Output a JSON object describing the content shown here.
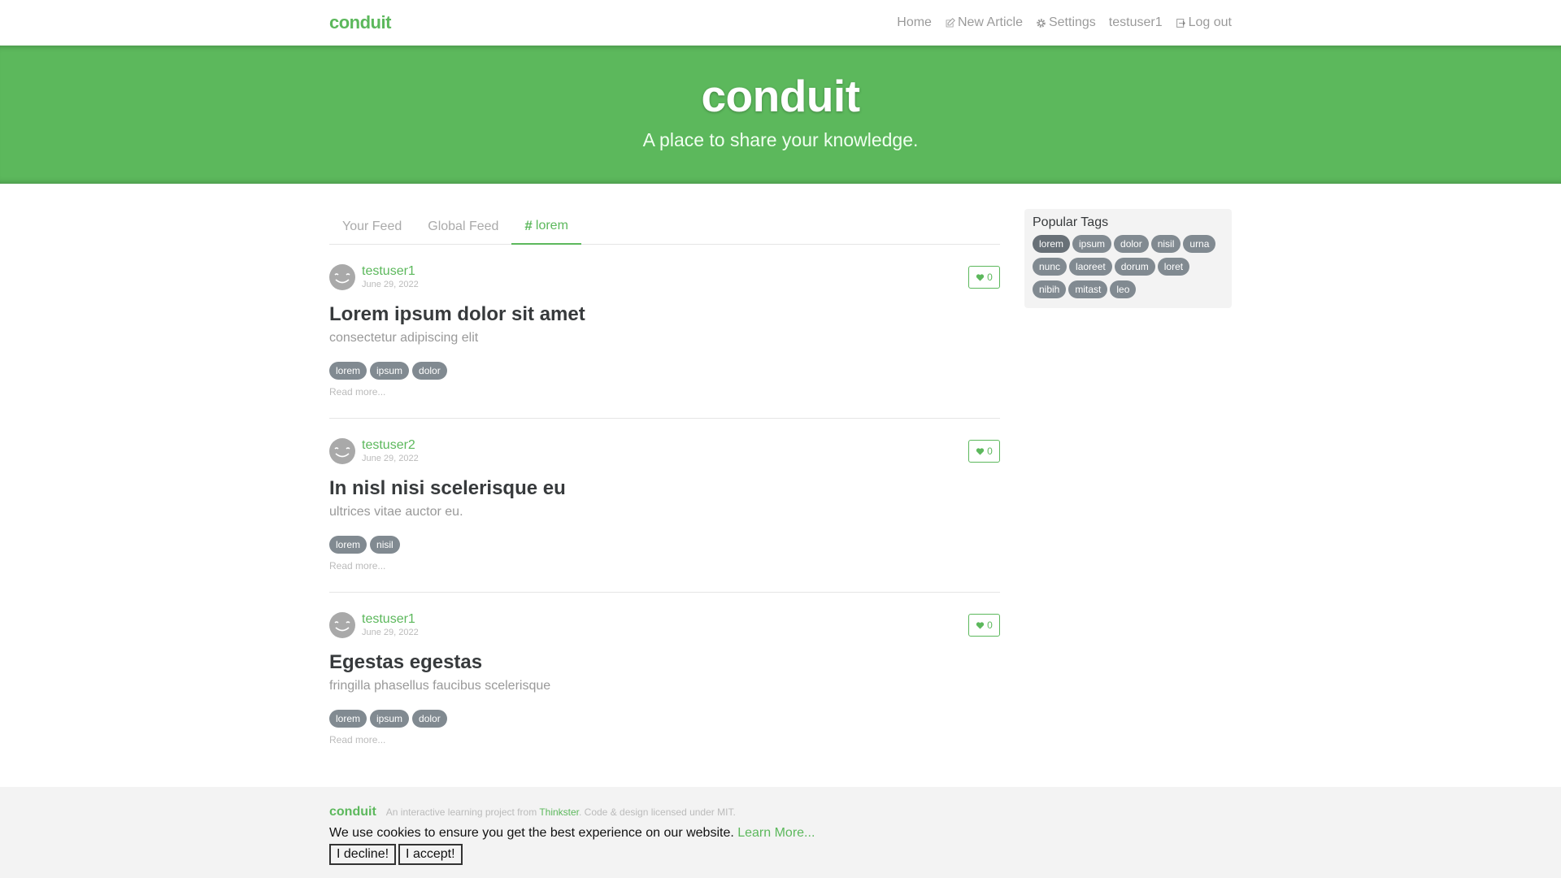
{
  "nav": {
    "brand": "conduit",
    "links": [
      "Home",
      "New Article",
      "Settings",
      "testuser1",
      "Log out"
    ]
  },
  "banner": {
    "title": "conduit",
    "subtitle": "A place to share your knowledge."
  },
  "feed": {
    "tabs": [
      "Your Feed",
      "Global Feed",
      "lorem"
    ],
    "active_tab": "lorem"
  },
  "articles": [
    {
      "author": "testuser1",
      "date": "June 29, 2022",
      "favorites": "0",
      "title": "Lorem ipsum dolor sit amet",
      "description": "consectetur adipiscing elit",
      "tags": [
        "lorem",
        "ipsum",
        "dolor"
      ],
      "read_more": "Read more..."
    },
    {
      "author": "testuser2",
      "date": "June 29, 2022",
      "favorites": "0",
      "title": "In nisl nisi scelerisque eu",
      "description": "ultrices vitae auctor eu.",
      "tags": [
        "lorem",
        "nisil"
      ],
      "read_more": "Read more..."
    },
    {
      "author": "testuser1",
      "date": "June 29, 2022",
      "favorites": "0",
      "title": "Egestas egestas",
      "description": "fringilla phasellus faucibus scelerisque",
      "tags": [
        "lorem",
        "ipsum",
        "dolor"
      ],
      "read_more": "Read more..."
    }
  ],
  "sidebar": {
    "heading": "Popular Tags",
    "tags": [
      "lorem",
      "ipsum",
      "dolor",
      "nisil",
      "urna",
      "nunc",
      "laoreet",
      "dorum",
      "loret",
      "nibih",
      "mitast",
      "leo"
    ],
    "selected": "lorem"
  },
  "footer": {
    "brand": "conduit",
    "attribution_prefix": "An interactive learning project from",
    "attribution_link": "Thinkster",
    "attribution_suffix": ". Code & design licensed under MIT.",
    "cookie_text": "We use cookies to ensure you get the best experience on our website.",
    "cookie_link": "Learn More...",
    "decline": "I decline!",
    "accept": "I accept!"
  },
  "colors": {
    "brand": "#5cb85c",
    "tag": "#818a91",
    "footer_bg": "#f3f3f3"
  }
}
